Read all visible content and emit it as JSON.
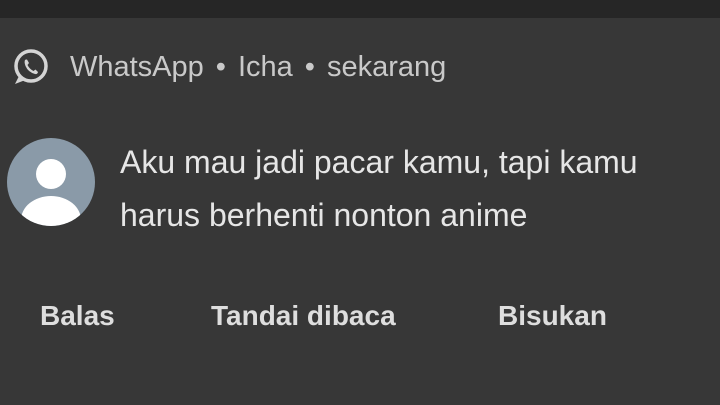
{
  "notification": {
    "app_name": "WhatsApp",
    "separator": "•",
    "sender": "Icha",
    "time": "sekarang",
    "app_icon": "whatsapp-icon",
    "avatar_icon": "default-avatar-icon",
    "message_lines": [
      "Aku mau jadi pacar kamu, tapi kamu",
      "harus berhenti nonton anime"
    ]
  },
  "actions": {
    "reply_label": "Balas",
    "mark_read_label": "Tandai dibaca",
    "mute_label": "Bisukan"
  },
  "colors": {
    "background": "#373737",
    "text_primary": "#e6e6e6",
    "text_secondary": "#c9c9c9",
    "avatar_bg": "#8a9aa8"
  }
}
